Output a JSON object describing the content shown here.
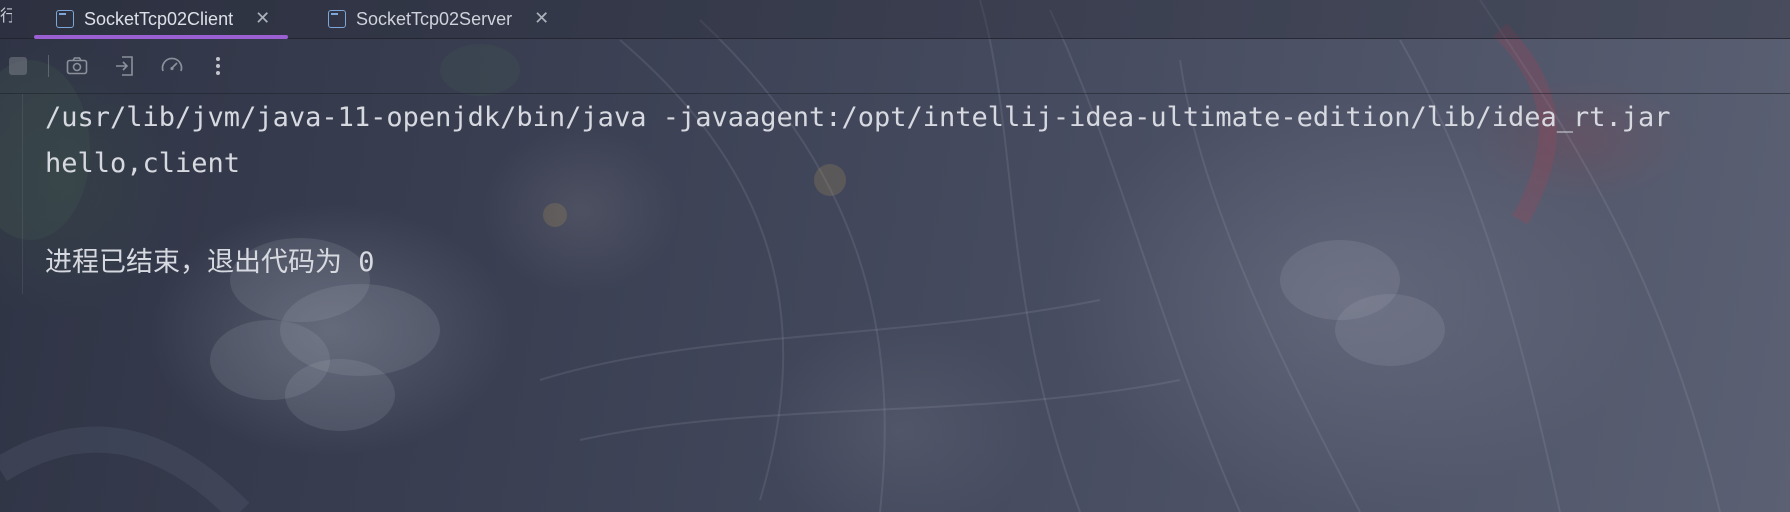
{
  "tabs": {
    "cut_label": "行",
    "items": [
      {
        "label": "SocketTcp02Client",
        "active": true
      },
      {
        "label": "SocketTcp02Server",
        "active": false
      }
    ],
    "close_glyph": "✕",
    "accent_color": "#9a5fd0"
  },
  "toolbar": {
    "buttons": [
      {
        "name": "stop-icon"
      },
      {
        "name": "camera-icon"
      },
      {
        "name": "exit-to-app-icon"
      },
      {
        "name": "gauge-icon"
      },
      {
        "name": "more-vertical-icon"
      }
    ]
  },
  "console": {
    "lines": [
      "/usr/lib/jvm/java-11-openjdk/bin/java -javaagent:/opt/intellij-idea-ultimate-edition/lib/idea_rt.jar",
      "hello,client",
      "进程已结束，退出代码为 0"
    ],
    "text_color": "#d7d9e0"
  }
}
